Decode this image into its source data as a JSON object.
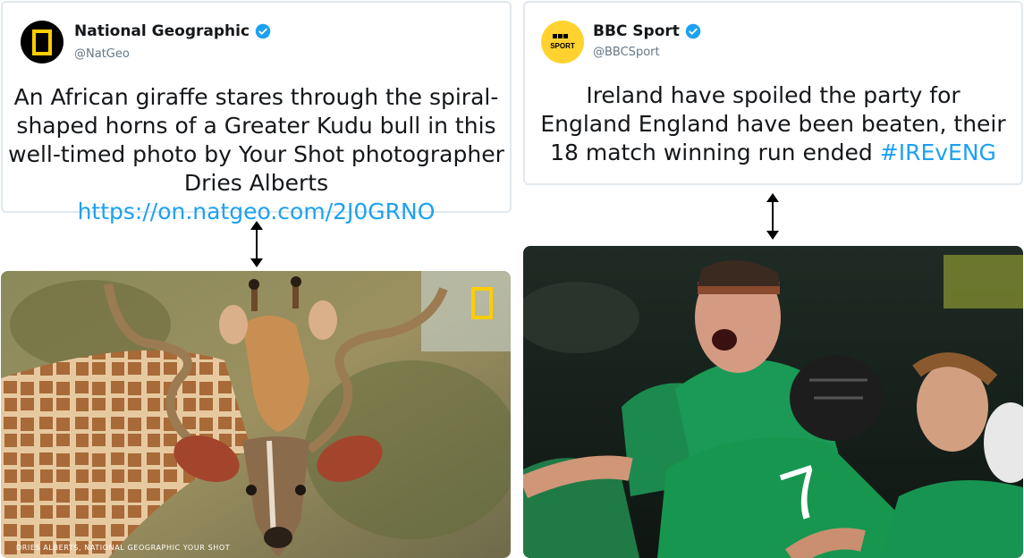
{
  "natgeo": {
    "name": "National Geographic",
    "handle": "@NatGeo",
    "text": "An African giraffe stares through the spiral-shaped horns of a Greater Kudu bull in this well-timed photo by Your Shot photographer Dries Alberts",
    "link": "https://on.natgeo.com/2J0GRNO",
    "photo_credit": "DRIES ALBERTS, NATIONAL GEOGRAPHIC YOUR SHOT",
    "accent": "#ffcd00"
  },
  "bbc": {
    "name": "BBC Sport",
    "handle": "@BBCSport",
    "logo_line1": "BBC",
    "logo_line2": "SPORT",
    "text": "Ireland have spoiled the party for England England have been beaten, their 18 match winning run ended",
    "hashtag": "#IREvENG",
    "accent": "#ffd230"
  },
  "colors": {
    "link": "#1da1f2",
    "verified": "#1da1f2",
    "border": "#e1e8ed"
  },
  "icons": [
    "natgeo-logo-icon",
    "verified-badge-icon",
    "bbc-sport-logo-icon",
    "double-arrow-icon"
  ]
}
